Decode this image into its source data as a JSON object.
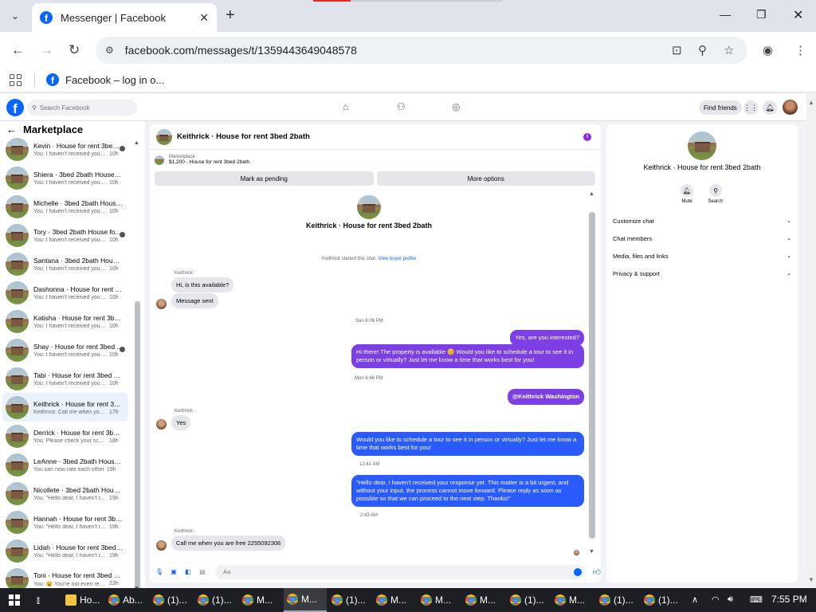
{
  "browser": {
    "tab_title": "Messenger | Facebook",
    "url": "facebook.com/messages/t/1359443649048578",
    "bookmark": "Facebook – log in o..."
  },
  "fb": {
    "search_placeholder": "Search Facebook",
    "find_friends": "Find friends"
  },
  "sidebar": {
    "title": "Marketplace",
    "conversations": [
      {
        "name": "Kevin · House for rent 3bed ...",
        "preview": "You: I haven't received your ...",
        "time": "10h",
        "seen": true
      },
      {
        "name": "Shiera · 3bed 2bath House for...",
        "preview": "You: I haven't received your res...",
        "time": "10h",
        "seen": false
      },
      {
        "name": "Michelle · 3bed 2bath House f...",
        "preview": "You: I haven't received your res...",
        "time": "10h",
        "seen": false
      },
      {
        "name": "Tory · 3bed 2bath House fo...",
        "preview": "You: I haven't received your ...",
        "time": "10h",
        "seen": true
      },
      {
        "name": "Santana · 3bed 2bath House f...",
        "preview": "You: I haven't received your res...",
        "time": "10h",
        "seen": false
      },
      {
        "name": "Dashonna · House for rent 3b...",
        "preview": "You: I haven't received your res...",
        "time": "10h",
        "seen": false
      },
      {
        "name": "Katisha · House for rent 3bed ...",
        "preview": "You: I haven't received your res...",
        "time": "10h",
        "seen": false
      },
      {
        "name": "Shay · House for rent 3bed ...",
        "preview": "You: I haven't received your ...",
        "time": "10h",
        "seen": true
      },
      {
        "name": "Tabi · House for rent 3bed 2ba...",
        "preview": "You: I haven't received your res...",
        "time": "10h",
        "seen": false
      },
      {
        "name": "Keithrick · House for rent 3be...",
        "preview": "Keithrick: Call me when you are...",
        "time": "17h",
        "seen": false,
        "active": true
      },
      {
        "name": "Derrick · House for rent 3bed ...",
        "preview": "You: Please check your score an...",
        "time": "18h",
        "seen": false
      },
      {
        "name": "LeAnne · 3bed 2bath House f...",
        "preview": "You can now rate each other",
        "time": "19h",
        "seen": false
      },
      {
        "name": "Nicollete · 3bed 2bath House ...",
        "preview": "You: \"Hello dear, I haven't recei...",
        "time": "19h",
        "seen": false
      },
      {
        "name": "Hannah · House for rent 3bed...",
        "preview": "You: \"Hello dear, I haven't recei...",
        "time": "19h",
        "seen": false
      },
      {
        "name": "Lidah · House for rent 3bed 2...",
        "preview": "You: \"Hello dear, I haven't recei...",
        "time": "19h",
        "seen": false
      },
      {
        "name": "Toni · House for rent 3bed 2b...",
        "preview": "You: 😮 You're not even replyin...",
        "time": "23h",
        "seen": false
      }
    ]
  },
  "chat": {
    "title": "Keithrick · House for rent 3bed 2bath",
    "marketplace_label": "Marketplace",
    "listing": "$1,200 · House for rent 3bed 2bath",
    "btn_pending": "Mark as pending",
    "btn_more": "More options",
    "intro_name": "Keithrick · House for rent 3bed 2bath",
    "started_text": "Keithrick started this chat.",
    "view_buyer": "View buyer profile",
    "sender": "Keithrick",
    "msg_in_1": "Hi, is this available?",
    "msg_in_2": "Message sent",
    "stamp_1": "Sun 8:06 PM",
    "msg_out_1": "Yes, are you interested?",
    "msg_out_2": "Hi there! The property is available 😊 Would you like to schedule a tour to see it in person or virtually? Just let me know a time that works best for you!",
    "stamp_2": "Mon 8:46 PM",
    "msg_out_3": "@Keithrick Washington",
    "msg_in_3": "Yes",
    "msg_out_4": "Would you like to schedule a tour to see it in person or virtually? Just let me know a time that works best for you!",
    "stamp_3": "12:41 AM",
    "msg_out_5": "\"Hello dear, I haven't received your response yet. This matter is a bit urgent, and without your input, the process cannot move forward. Please reply as soon as possible so that we can proceed to the next step. Thanks!\"",
    "stamp_4": "2:43 AM",
    "msg_in_4": "Call me when you are free 2255092306",
    "input_placeholder": "Aa"
  },
  "rightpanel": {
    "name": "Keithrick · House for rent 3bed 2bath",
    "mute": "Mute",
    "search": "Search",
    "rows": [
      "Customize chat",
      "Chat members",
      "Media, files and links",
      "Privacy & support"
    ]
  },
  "taskbar": {
    "items": [
      "Ho...",
      "Ab...",
      "(1)...",
      "(1)...",
      "M...",
      "M...",
      "(1)...",
      "M...",
      "M...",
      "M...",
      "(1)...",
      "M...",
      "(1)...",
      "(1)..."
    ],
    "time": "7:55 PM"
  },
  "colors": {
    "fb_blue": "#0866ff",
    "bubble_violet": "#7b3fe4",
    "bubble_blue": "#2a5bff"
  }
}
